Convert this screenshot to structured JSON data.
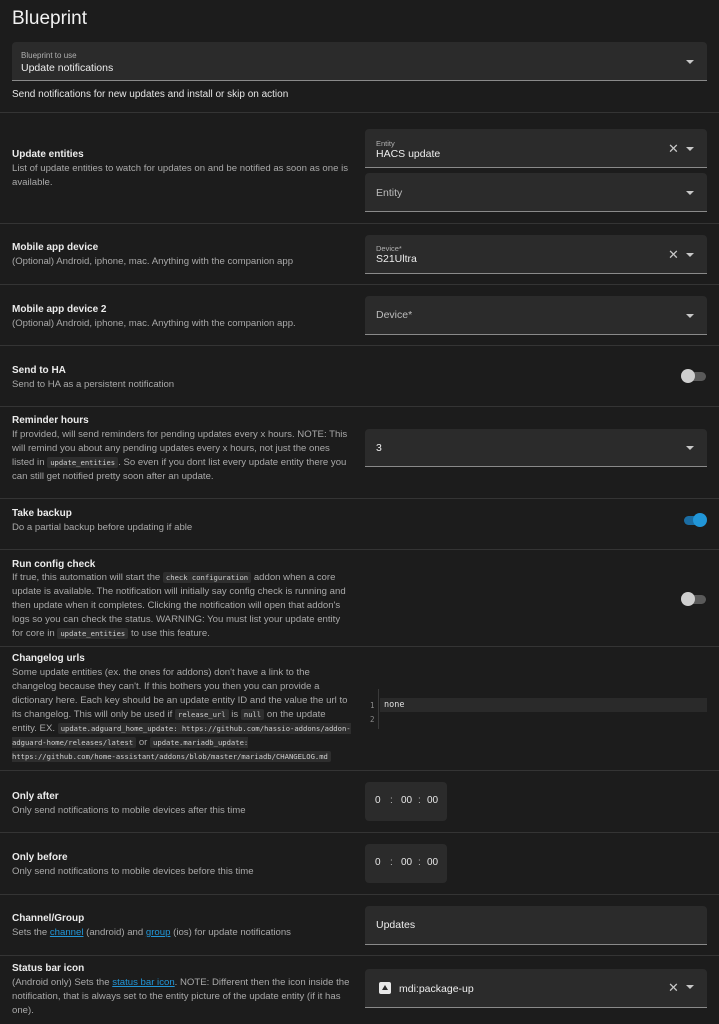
{
  "page": {
    "title": "Blueprint"
  },
  "blueprint_select": {
    "label": "Blueprint to use",
    "value": "Update notifications"
  },
  "blueprint_description": "Send notifications for new updates and install or skip on action",
  "update_entities": {
    "title": "Update entities",
    "desc": "List of update entities to watch for updates on and be notified as soon as one is available.",
    "field1_label": "Entity",
    "field1_value": "HACS update",
    "field2_placeholder": "Entity"
  },
  "mobile_device": {
    "title": "Mobile app device",
    "desc": "(Optional) Android, iphone, mac. Anything with the companion app",
    "label": "Device*",
    "value": "S21Ultra"
  },
  "mobile_device2": {
    "title": "Mobile app device 2",
    "desc": "(Optional) Android, iphone, mac. Anything with the companion app.",
    "placeholder": "Device*"
  },
  "send_to_ha": {
    "title": "Send to HA",
    "desc": "Send to HA as a persistent notification",
    "enabled": false
  },
  "reminder_hours": {
    "title": "Reminder hours",
    "desc_a": "If provided, will send reminders for pending updates every x hours. NOTE: This will remind you about any pending updates every x hours, not just the ones listed in",
    "code1": "update_entities",
    "desc_b": ". So even if you dont list every update entity there you can still get notified pretty soon after an update.",
    "value": "3"
  },
  "take_backup": {
    "title": "Take backup",
    "desc": "Do a partial backup before updating if able",
    "enabled": true
  },
  "config_check": {
    "title": "Run config check",
    "desc_a": "If true, this automation will start the",
    "code1": "check configuration",
    "desc_b": "addon when a core update is available. The notification will initially say config check is running and then update when it completes. Clicking the notification will open that addon's logs so you can check the status. WARNING: You must list your update entity for core in",
    "code2": "update_entities",
    "desc_c": "to use this feature.",
    "enabled": false
  },
  "changelog": {
    "title": "Changelog urls",
    "desc_a": "Some update entities (ex. the ones for addons) don't have a link to the changelog because they can't. If this bothers you then you can provide a dictionary here. Each key should be an update entity ID and the value the url to its changelog. This will only be used if",
    "code1": "release_url",
    "desc_b": "is",
    "code2": "null",
    "desc_c": "on the update entity. EX.",
    "code3": "update.adguard_home_update: https://github.com/hassio-addons/addon-adguard-home/releases/latest",
    "desc_d": "or",
    "code4": "update.mariadb_update: https://github.com/home-assistant/addons/blob/master/mariadb/CHANGELOG.md",
    "line1_num": "1",
    "line2_num": "2",
    "editor_text": "none"
  },
  "only_after": {
    "title": "Only after",
    "desc": "Only send notifications to mobile devices after this time",
    "h": "0",
    "m": "00",
    "s": "00"
  },
  "only_before": {
    "title": "Only before",
    "desc": "Only send notifications to mobile devices before this time",
    "h": "0",
    "m": "00",
    "s": "00"
  },
  "channel": {
    "title": "Channel/Group",
    "desc_a": "Sets the",
    "link1": "channel",
    "desc_b": "(android) and",
    "link2": "group",
    "desc_c": "(ios) for update notifications",
    "value": "Updates"
  },
  "status_icon": {
    "title": "Status bar icon",
    "desc_a": "(Android only) Sets the",
    "link1": "status bar icon",
    "desc_b": ". NOTE: Different then the icon inside the notification, that is always set to the entity picture of the update entity (if it has one).",
    "value": "mdi:package-up"
  },
  "time_separator": ":",
  "clear_glyph": "✕",
  "colors": {
    "accent": "#2196d8",
    "background": "#1c1c1c",
    "field": "#2b2b2b"
  }
}
